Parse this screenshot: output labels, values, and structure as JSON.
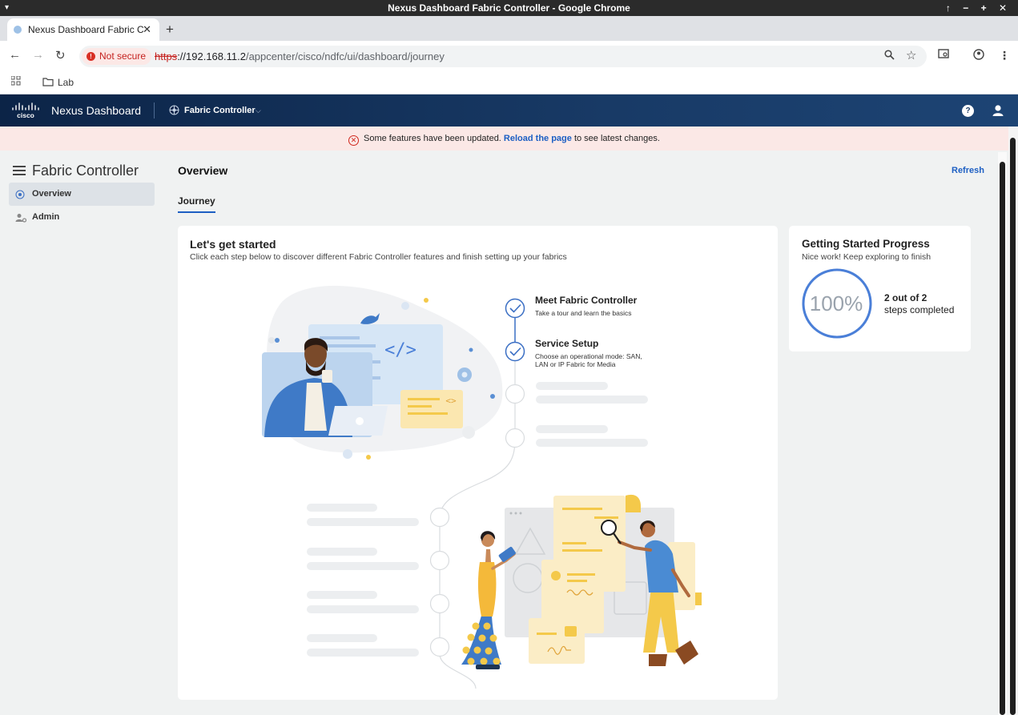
{
  "window": {
    "title": "Nexus Dashboard Fabric Controller - Google Chrome",
    "controls": "↑ − + ✕"
  },
  "tab": {
    "title": "Nexus Dashboard Fabric C",
    "close": "✕",
    "new": "+"
  },
  "toolbar": {
    "not_secure": "Not secure",
    "url_scheme": "https",
    "url_host": "://192.168.11.2",
    "url_path": "/appcenter/cisco/ndfc/ui/dashboard/journey"
  },
  "bookmarks": {
    "folder": "Lab"
  },
  "header": {
    "logo_text": "cisco",
    "app_name": "Nexus Dashboard",
    "service": "Fabric Controller",
    "help": "?"
  },
  "banner": {
    "prefix": "Some features have been updated. ",
    "link": "Reload the page",
    "suffix": " to see latest changes."
  },
  "sidebar": {
    "title": "Fabric Controller",
    "items": [
      {
        "label": "Overview",
        "active": true
      },
      {
        "label": "Admin",
        "active": false
      }
    ]
  },
  "main": {
    "title": "Overview",
    "refresh": "Refresh",
    "tab": "Journey"
  },
  "journey": {
    "title": "Let's get started",
    "subtitle": "Click each step below to discover different Fabric Controller features and finish setting up your fabrics",
    "steps": [
      {
        "title": "Meet Fabric Controller",
        "desc": "Take a tour and learn the basics",
        "done": true
      },
      {
        "title": "Service Setup",
        "desc": "Choose an operational mode: SAN, LAN or IP Fabric for Media",
        "done": true
      }
    ]
  },
  "progress": {
    "title": "Getting Started Progress",
    "subtitle": "Nice work! Keep exploring to finish",
    "percent_label": "100%",
    "percent_value": 1.0,
    "count": "2 out of 2",
    "suffix": "steps completed"
  },
  "colors": {
    "accent": "#1d5fc3",
    "ring": "#4a7fd8",
    "header_dark": "#0c2447",
    "banner_bg": "#fbe8e6"
  }
}
